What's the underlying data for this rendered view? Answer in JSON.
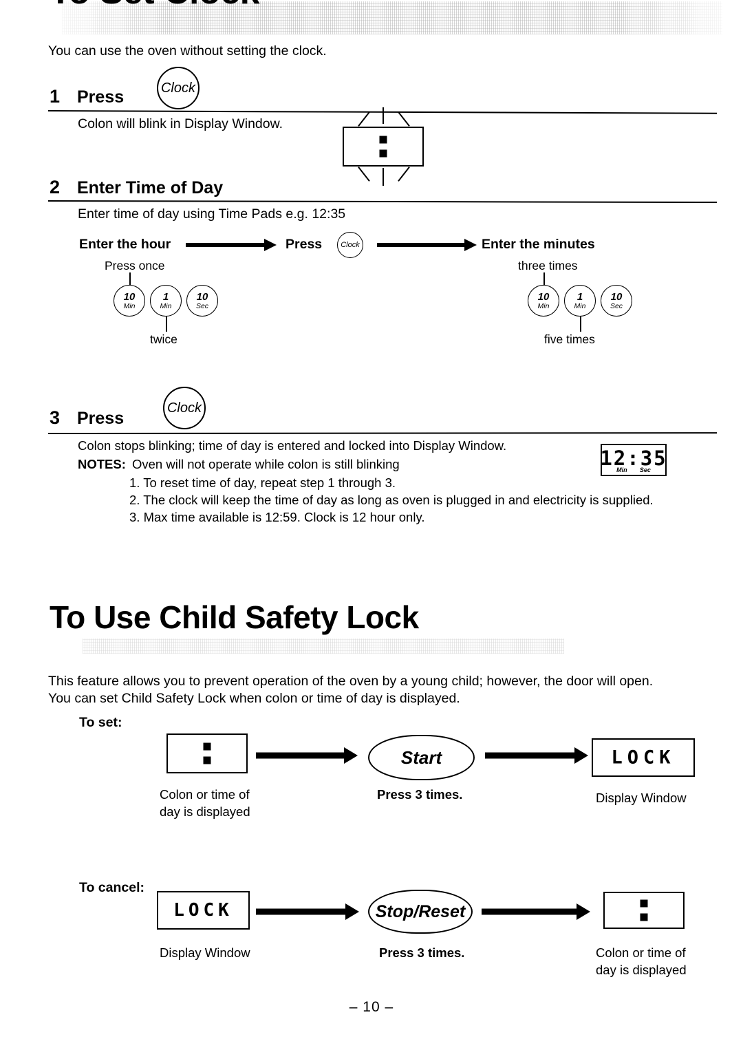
{
  "page": {
    "number_label": "– 10 –"
  },
  "section_clock": {
    "title": "To Set Clock",
    "intro": "You can use the oven without setting the clock.",
    "step1": {
      "number": "1",
      "label": "Press",
      "key_label": "Clock",
      "body": "Colon will blink in Display Window."
    },
    "step2": {
      "number": "2",
      "label": "Enter Time of Day",
      "body": "Enter time of day using Time Pads e.g. 12:35",
      "left_heading": "Enter the hour",
      "mid_label": "Press",
      "mid_key_label": "Clock",
      "right_heading": "Enter the minutes",
      "left_top_note": "Press once",
      "left_bottom_note": "twice",
      "right_top_note": "three times",
      "right_bottom_note": "five times",
      "pads": [
        {
          "main": "10",
          "sub": "Min"
        },
        {
          "main": "1",
          "sub": "Min"
        },
        {
          "main": "10",
          "sub": "Sec"
        }
      ]
    },
    "step3": {
      "number": "3",
      "label": "Press",
      "key_label": "Clock",
      "body": "Colon stops blinking; time of day is entered and locked into Display Window.",
      "notes_label": "NOTES:",
      "notes_lead": "Oven will not operate while colon is still blinking",
      "notes": [
        "1. To reset time of day, repeat step 1 through 3.",
        "2. The clock will keep the time of day as long as oven is plugged in and electricity is supplied.",
        "3. Max time available is 12:59. Clock is 12 hour only."
      ],
      "display": {
        "value": "12:35",
        "sub_left": "Min",
        "sub_right": "Sec"
      }
    }
  },
  "section_lock": {
    "title": "To Use Child Safety Lock",
    "intro_line1": "This feature allows you to prevent operation of the oven by a young child; however, the door will open.",
    "intro_line2": "You can set Child Safety Lock when colon or time of day is displayed.",
    "to_set": {
      "label": "To set:",
      "start_display_caption_line1": "Colon or time of",
      "start_display_caption_line2": "day is displayed",
      "button_label": "Start",
      "button_caption": "Press 3 times.",
      "end_display_value": "LOCK",
      "end_display_caption": "Display Window"
    },
    "to_cancel": {
      "label": "To cancel:",
      "start_display_value": "LOCK",
      "start_display_caption": "Display Window",
      "button_label": "Stop/Reset",
      "button_caption": "Press 3 times.",
      "end_display_caption_line1": "Colon or time of",
      "end_display_caption_line2": "day is displayed"
    }
  }
}
